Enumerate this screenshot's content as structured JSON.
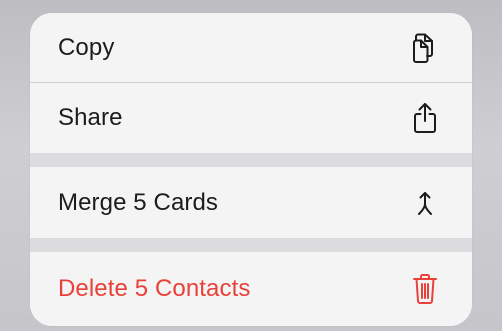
{
  "menu": {
    "items": [
      {
        "label": "Copy",
        "icon": "copy-icon"
      },
      {
        "label": "Share",
        "icon": "share-icon"
      },
      {
        "label": "Merge 5 Cards",
        "icon": "merge-icon"
      },
      {
        "label": "Delete 5 Contacts",
        "icon": "trash-icon",
        "destructive": true
      }
    ]
  },
  "colors": {
    "text": "#1c1c1e",
    "destructive": "#e8413a",
    "menu_background": "#f4f4f4",
    "group_gap": "#dcdcde"
  }
}
